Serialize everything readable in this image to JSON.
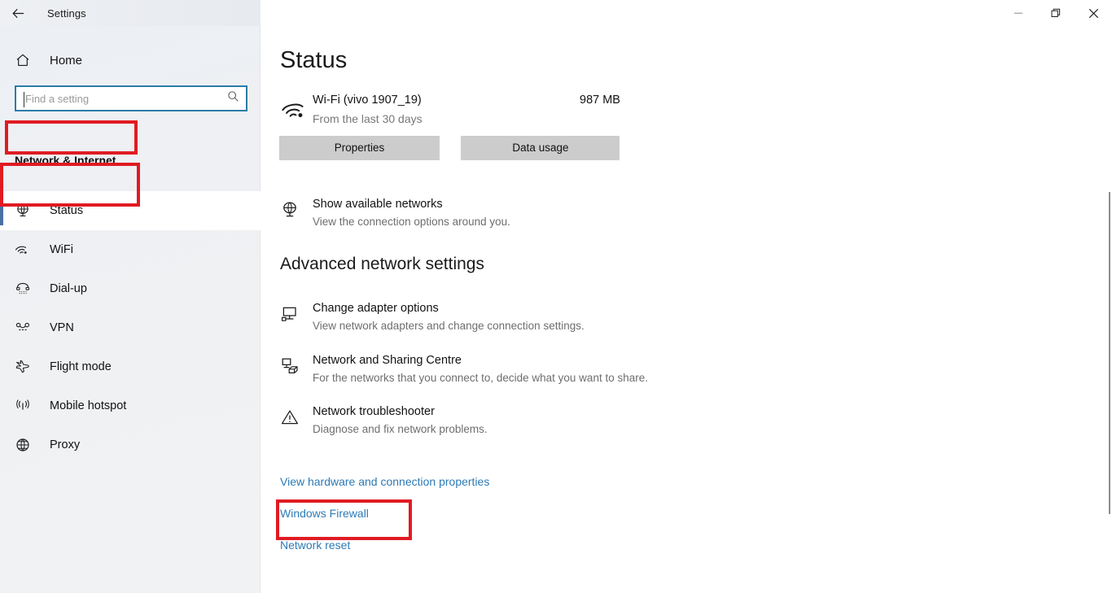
{
  "titlebar": {
    "back_icon": "back-arrow-icon",
    "title": "Settings",
    "minimize_label": "Minimize",
    "restore_label": "Restore",
    "close_label": "Close"
  },
  "sidebar": {
    "home": {
      "label": "Home",
      "icon": "home-icon"
    },
    "search": {
      "placeholder": "Find a setting",
      "value": "",
      "icon": "search-icon"
    },
    "category_title": "Network & Internet",
    "items": [
      {
        "label": "Status",
        "icon": "status-globe-icon",
        "selected": true
      },
      {
        "label": "WiFi",
        "icon": "wifi-icon",
        "selected": false
      },
      {
        "label": "Dial-up",
        "icon": "dialup-phone-icon",
        "selected": false
      },
      {
        "label": "VPN",
        "icon": "vpn-icon",
        "selected": false
      },
      {
        "label": "Flight mode",
        "icon": "airplane-icon",
        "selected": false
      },
      {
        "label": "Mobile hotspot",
        "icon": "hotspot-icon",
        "selected": false
      },
      {
        "label": "Proxy",
        "icon": "globe-icon",
        "selected": false
      }
    ]
  },
  "main": {
    "page_title": "Status",
    "network": {
      "name": "Wi-Fi (vivo 1907_19)",
      "subtitle": "From the last 30 days",
      "usage": "987 MB",
      "icon": "wifi-icon"
    },
    "buttons": {
      "properties": "Properties",
      "data_usage": "Data usage"
    },
    "show_networks": {
      "title": "Show available networks",
      "desc": "View the connection options around you.",
      "icon": "globe-monitor-icon"
    },
    "section_heading": "Advanced network settings",
    "rows": [
      {
        "title": "Change adapter options",
        "desc": "View network adapters and change connection settings.",
        "icon": "monitor-icon"
      },
      {
        "title": "Network and Sharing Centre",
        "desc": "For the networks that you connect to, decide what you want to share.",
        "icon": "sharing-icon"
      },
      {
        "title": "Network troubleshooter",
        "desc": "Diagnose and fix network problems.",
        "icon": "warning-triangle-icon"
      }
    ],
    "links": [
      {
        "label": "View hardware and connection properties"
      },
      {
        "label": "Windows Firewall"
      },
      {
        "label": "Network reset"
      }
    ]
  },
  "annotations": {
    "highlight_color": "#e01b22",
    "boxes": [
      {
        "target": "Network & Internet"
      },
      {
        "target": "Status"
      },
      {
        "target": "Network reset"
      }
    ]
  },
  "colors": {
    "link": "#2c7ab5",
    "search_border": "#2a7ca6",
    "button_bg": "#cccccc",
    "selection_bar": "#4a6fa5"
  }
}
